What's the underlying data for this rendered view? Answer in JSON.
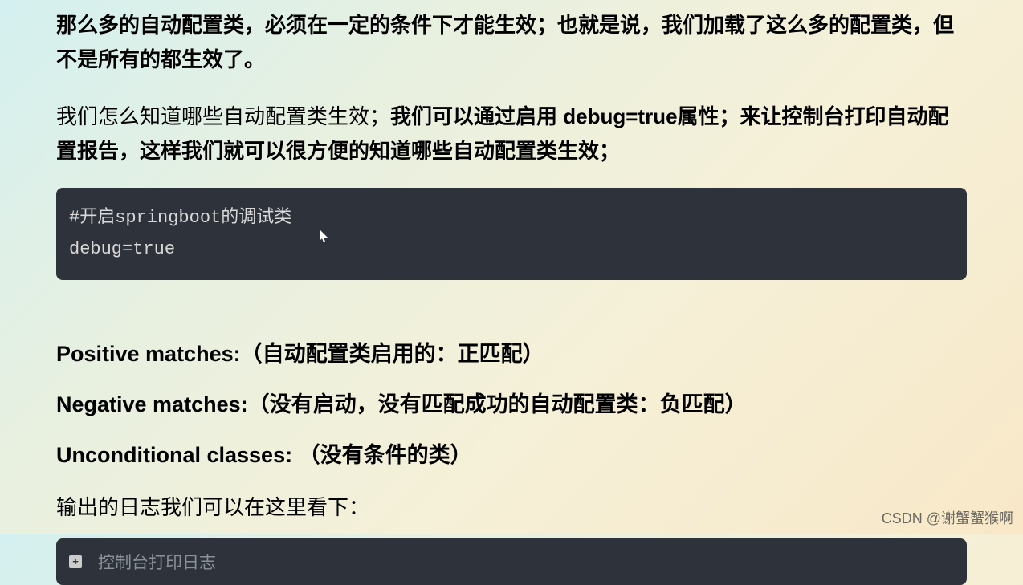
{
  "para1": "那么多的自动配置类，必须在一定的条件下才能生效；也就是说，我们加载了这么多的配置类，但不是所有的都生效了。",
  "para2_normal": "我们怎么知道哪些自动配置类生效；",
  "para2_bold": "我们可以通过启用 debug=true属性；来让控制台打印自动配置报告，这样我们就可以很方便的知道哪些自动配置类生效；",
  "code": {
    "line1": "#开启springboot的调试类",
    "line2_key": "debug",
    "line2_eq": "=",
    "line2_value": "true"
  },
  "matches": {
    "positive": "Positive matches:（自动配置类启用的：正匹配）",
    "negative": "Negative matches:（没有启动，没有匹配成功的自动配置类：负匹配）",
    "unconditional": "Unconditional classes:  （没有条件的类）"
  },
  "output_text": "输出的日志我们可以在这里看下：",
  "collapse": {
    "icon": "+",
    "text": "控制台打印日志"
  },
  "watermark": "CSDN @谢蟹蟹猴啊"
}
